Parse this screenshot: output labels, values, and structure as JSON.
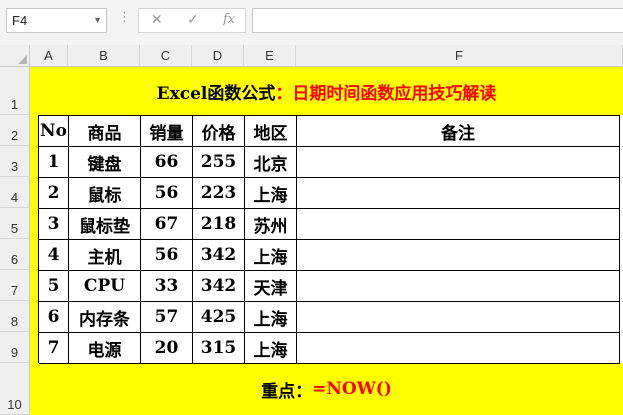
{
  "formula_bar": {
    "name_box": "F4",
    "cancel_glyph": "✕",
    "enter_glyph": "✓",
    "fx_glyph": "fx",
    "formula": ""
  },
  "columns": [
    "A",
    "B",
    "C",
    "D",
    "E",
    "F"
  ],
  "rows": [
    "1",
    "2",
    "3",
    "4",
    "5",
    "6",
    "7",
    "8",
    "9",
    "10"
  ],
  "title": {
    "part1": "Excel函数公式",
    "part2": "：日期时间函数应用技巧解读"
  },
  "table": {
    "headers": [
      "No",
      "商品",
      "销量",
      "价格",
      "地区",
      "备注"
    ],
    "rows": [
      [
        "1",
        "键盘",
        "66",
        "255",
        "北京",
        ""
      ],
      [
        "2",
        "鼠标",
        "56",
        "223",
        "上海",
        ""
      ],
      [
        "3",
        "鼠标垫",
        "67",
        "218",
        "苏州",
        ""
      ],
      [
        "4",
        "主机",
        "56",
        "342",
        "上海",
        ""
      ],
      [
        "5",
        "CPU",
        "33",
        "342",
        "天津",
        ""
      ],
      [
        "6",
        "内存条",
        "57",
        "425",
        "上海",
        ""
      ],
      [
        "7",
        "电源",
        "20",
        "315",
        "上海",
        ""
      ]
    ]
  },
  "note": {
    "label": "重点：",
    "formula": "=NOW()"
  },
  "colors": {
    "highlight": "#ffff00",
    "accent_red": "#ff0000"
  }
}
